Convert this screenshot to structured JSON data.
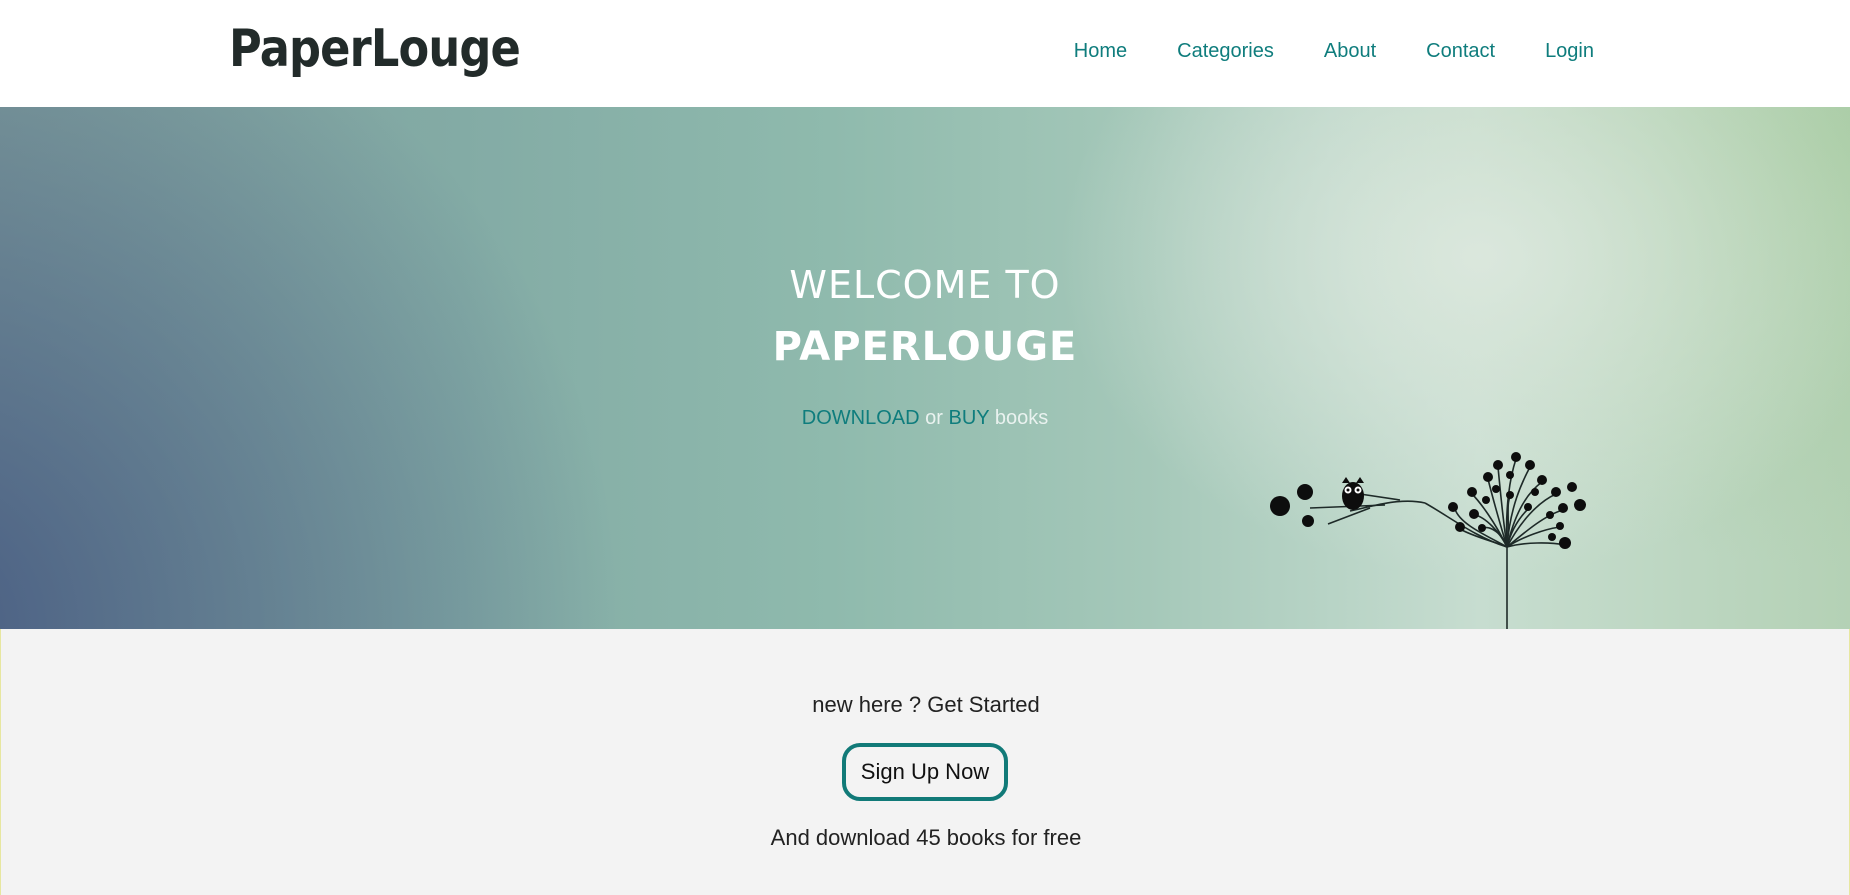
{
  "navbar": {
    "brand": "PaperLouge",
    "links": [
      "Home",
      "Categories",
      "About",
      "Contact",
      "Login"
    ]
  },
  "hero": {
    "title_line1": "WELCOME TO",
    "title_line2": "PAPERLOUGE",
    "subtitle": {
      "download": "DOWNLOAD",
      "or": "or",
      "buy": "BUY",
      "books": "books"
    }
  },
  "signup": {
    "prompt": "new here ? Get Started",
    "button_label": "Sign Up Now",
    "offer": "And download 45 books for free"
  },
  "colors": {
    "accent": "#0f7d7d",
    "nav_background": "#ffffff",
    "section_background": "#f3f3f3"
  },
  "icons": {
    "hero_illustration": "tree-with-owl-icon"
  }
}
